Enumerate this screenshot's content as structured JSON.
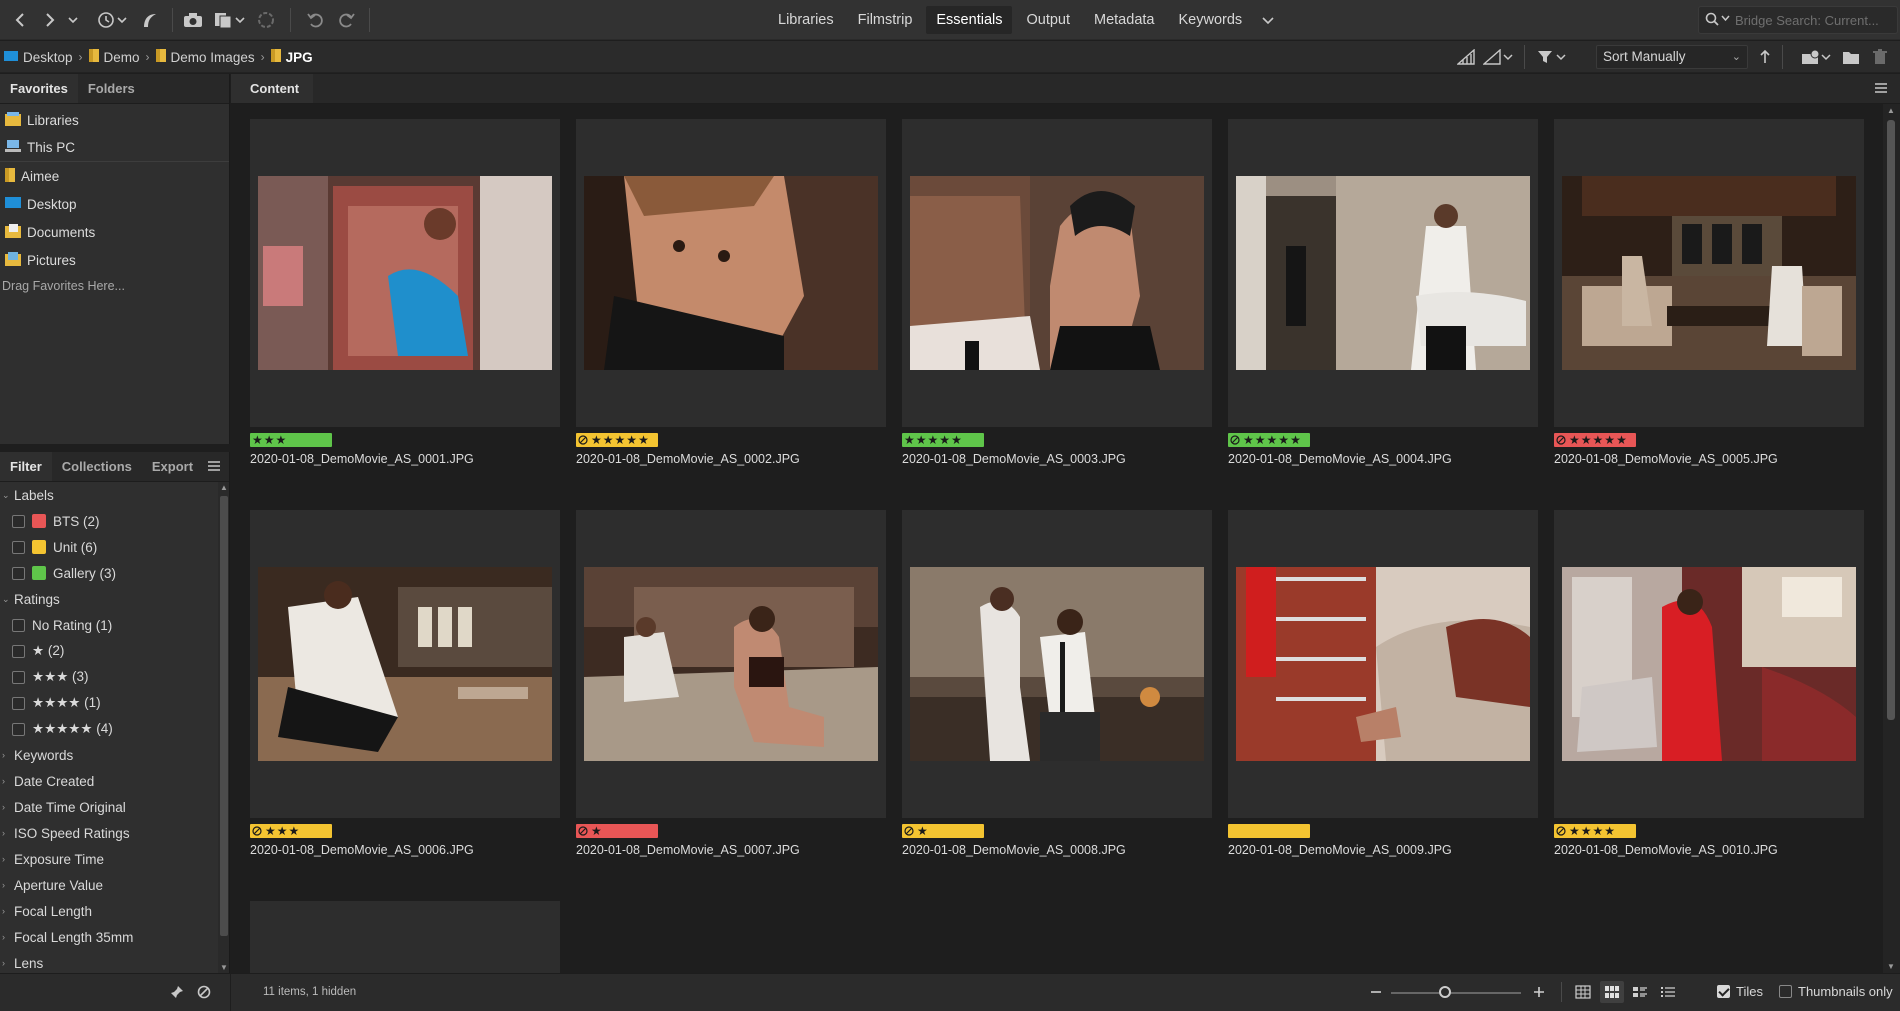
{
  "colors": {
    "accent": "#1e88e5",
    "label_green": "#5fc54a",
    "label_yellow": "#f4c431",
    "label_red": "#e85656",
    "folder_yellow": "#e7b93e"
  },
  "toolbar": {
    "icons": [
      "back-icon",
      "forward-icon",
      "chevron-down-icon",
      "recent-icon",
      "boomerang-icon",
      "camera-icon",
      "copy-icon",
      "refine-icon",
      "rotate-left-icon",
      "rotate-right-icon"
    ]
  },
  "workspaces": {
    "tabs": [
      {
        "label": "Libraries",
        "active": false
      },
      {
        "label": "Filmstrip",
        "active": false
      },
      {
        "label": "Essentials",
        "active": true
      },
      {
        "label": "Output",
        "active": false
      },
      {
        "label": "Metadata",
        "active": false
      },
      {
        "label": "Keywords",
        "active": false
      }
    ]
  },
  "search": {
    "placeholder": "Bridge Search: Current..."
  },
  "breadcrumb": [
    {
      "label": "Desktop",
      "icon": "desktop-icon"
    },
    {
      "label": "Demo",
      "icon": "folder-icon"
    },
    {
      "label": "Demo Images",
      "icon": "folder-icon"
    },
    {
      "label": "JPG",
      "icon": "folder-icon"
    }
  ],
  "sort": {
    "label": "Sort Manually"
  },
  "favorites_panel": {
    "tabs": [
      "Favorites",
      "Folders"
    ],
    "items": [
      {
        "label": "Libraries",
        "icon": "libraries-icon"
      },
      {
        "label": "This PC",
        "icon": "computer-icon"
      },
      {
        "label": "Aimee",
        "icon": "folder-icon"
      },
      {
        "label": "Desktop",
        "icon": "desktop-icon"
      },
      {
        "label": "Documents",
        "icon": "documents-icon"
      },
      {
        "label": "Pictures",
        "icon": "pictures-icon"
      }
    ],
    "hint": "Drag Favorites Here..."
  },
  "filter_panel": {
    "tabs": [
      "Filter",
      "Collections",
      "Export"
    ],
    "labels_heading": "Labels",
    "labels": [
      {
        "text": "BTS (2)",
        "color": "#e85656"
      },
      {
        "text": "Unit (6)",
        "color": "#f4c431"
      },
      {
        "text": "Gallery (3)",
        "color": "#5fc54a"
      }
    ],
    "ratings_heading": "Ratings",
    "ratings": [
      "No Rating (1)",
      "★ (2)",
      "★★★ (3)",
      "★★★★ (1)",
      "★★★★★ (4)"
    ],
    "collapsed_sections": [
      "Keywords",
      "Date Created",
      "Date Time Original",
      "ISO Speed Ratings",
      "Exposure Time",
      "Aperture Value",
      "Focal Length",
      "Focal Length 35mm",
      "Lens"
    ]
  },
  "content": {
    "tab": "Content",
    "items": [
      {
        "name": "2020-01-08_DemoMovie_AS_0001.JPG",
        "label_color": "#5fc54a",
        "rating": 3,
        "reject_icon": false
      },
      {
        "name": "2020-01-08_DemoMovie_AS_0002.JPG",
        "label_color": "#f4c431",
        "rating": 5,
        "reject_icon": true
      },
      {
        "name": "2020-01-08_DemoMovie_AS_0003.JPG",
        "label_color": "#5fc54a",
        "rating": 5,
        "reject_icon": false
      },
      {
        "name": "2020-01-08_DemoMovie_AS_0004.JPG",
        "label_color": "#5fc54a",
        "rating": 5,
        "reject_icon": true
      },
      {
        "name": "2020-01-08_DemoMovie_AS_0005.JPG",
        "label_color": "#e85656",
        "rating": 5,
        "reject_icon": true
      },
      {
        "name": "2020-01-08_DemoMovie_AS_0006.JPG",
        "label_color": "#f4c431",
        "rating": 3,
        "reject_icon": true
      },
      {
        "name": "2020-01-08_DemoMovie_AS_0007.JPG",
        "label_color": "#e85656",
        "rating": 1,
        "reject_icon": true
      },
      {
        "name": "2020-01-08_DemoMovie_AS_0008.JPG",
        "label_color": "#f4c431",
        "rating": 1,
        "reject_icon": true
      },
      {
        "name": "2020-01-08_DemoMovie_AS_0009.JPG",
        "label_color": "#f4c431",
        "rating": 0,
        "reject_icon": false
      },
      {
        "name": "2020-01-08_DemoMovie_AS_0010.JPG",
        "label_color": "#f4c431",
        "rating": 4,
        "reject_icon": true
      }
    ]
  },
  "status": {
    "text": "11 items, 1 hidden"
  },
  "footer": {
    "tiles_label": "Tiles",
    "thumbnails_only_label": "Thumbnails only",
    "tiles_checked": true,
    "thumbnails_only_checked": false
  }
}
